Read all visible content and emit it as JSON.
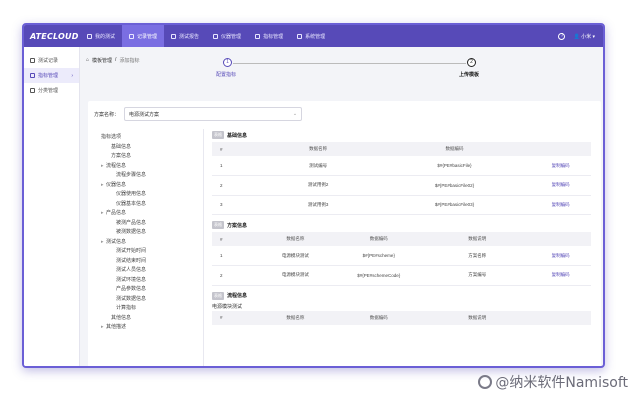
{
  "app": {
    "logo": "ATECLOUD"
  },
  "topnav": [
    {
      "label": "我的测试",
      "active": false
    },
    {
      "label": "记录管理",
      "active": true
    },
    {
      "label": "测试报告",
      "active": false
    },
    {
      "label": "仪器管理",
      "active": false
    },
    {
      "label": "指标管理",
      "active": false
    },
    {
      "label": "系统管理",
      "active": false
    }
  ],
  "user": {
    "help": "?",
    "name": "小米"
  },
  "sidebar": [
    {
      "label": "测试记录",
      "active": false
    },
    {
      "label": "指标管理",
      "active": true
    },
    {
      "label": "分类管理",
      "active": false
    }
  ],
  "breadcrumb": {
    "root": "模板管理",
    "sep": "/",
    "current": "添加指标"
  },
  "steps": [
    {
      "num": "1",
      "label": "配置指标"
    },
    {
      "num": "2",
      "label": "上传模板"
    }
  ],
  "select": {
    "label": "方案名称：",
    "value": "电源测试方案"
  },
  "tree": [
    {
      "text": "指标选项",
      "indent": 0,
      "toggle": ""
    },
    {
      "text": "基础信息",
      "indent": 2,
      "toggle": ""
    },
    {
      "text": "方案信息",
      "indent": 2,
      "toggle": ""
    },
    {
      "text": "流程信息",
      "indent": 1,
      "toggle": "▸"
    },
    {
      "text": "流程步骤信息",
      "indent": 3,
      "toggle": ""
    },
    {
      "text": "仪器信息",
      "indent": 1,
      "toggle": "▸"
    },
    {
      "text": "仪器使用信息",
      "indent": 3,
      "toggle": ""
    },
    {
      "text": "仪器基本信息",
      "indent": 3,
      "toggle": ""
    },
    {
      "text": "产品信息",
      "indent": 1,
      "toggle": "▸"
    },
    {
      "text": "被测产品信息",
      "indent": 3,
      "toggle": ""
    },
    {
      "text": "被测数据信息",
      "indent": 3,
      "toggle": ""
    },
    {
      "text": "测试信息",
      "indent": 1,
      "toggle": "▸"
    },
    {
      "text": "测试开始时间",
      "indent": 3,
      "toggle": ""
    },
    {
      "text": "测试结束时间",
      "indent": 3,
      "toggle": ""
    },
    {
      "text": "测试人员信息",
      "indent": 3,
      "toggle": ""
    },
    {
      "text": "测试环境信息",
      "indent": 3,
      "toggle": ""
    },
    {
      "text": "产品参数信息",
      "indent": 3,
      "toggle": ""
    },
    {
      "text": "测试数据信息",
      "indent": 3,
      "toggle": ""
    },
    {
      "text": "计算指标",
      "indent": 3,
      "toggle": ""
    },
    {
      "text": "其他信息",
      "indent": 2,
      "toggle": ""
    },
    {
      "text": "其他描述",
      "indent": 1,
      "toggle": "▸"
    }
  ],
  "sections": {
    "basic": {
      "tag": "表格",
      "title": "基础信息",
      "columns": [
        "#",
        "数据名称",
        "数据编码",
        ""
      ],
      "rows": [
        [
          "1",
          "测试编号",
          "$#{PE#basicFile}",
          "复制编码"
        ],
        [
          "2",
          "测试用例2",
          "$#{PE#basicFile02}",
          "复制编码"
        ],
        [
          "3",
          "测试用例3",
          "$#{PE#basicFile03}",
          "复制编码"
        ]
      ]
    },
    "scheme": {
      "tag": "表格",
      "title": "方案信息",
      "columns": [
        "#",
        "数据名称",
        "数据编码",
        "数据说明",
        ""
      ],
      "rows": [
        [
          "1",
          "电源模块测试",
          "$#{PE#scheme}",
          "方案名称",
          "复制编码"
        ],
        [
          "2",
          "电源模块测试",
          "$#{PE#schemeCode}",
          "方案编号",
          "复制编码"
        ]
      ]
    },
    "flow": {
      "tag": "表格",
      "title": "流程信息",
      "subtitle": "电源模块测试",
      "columns": [
        "#",
        "数据名称",
        "数据编码",
        "数据说明",
        ""
      ]
    }
  },
  "watermark": "@纳米软件Namisoft"
}
